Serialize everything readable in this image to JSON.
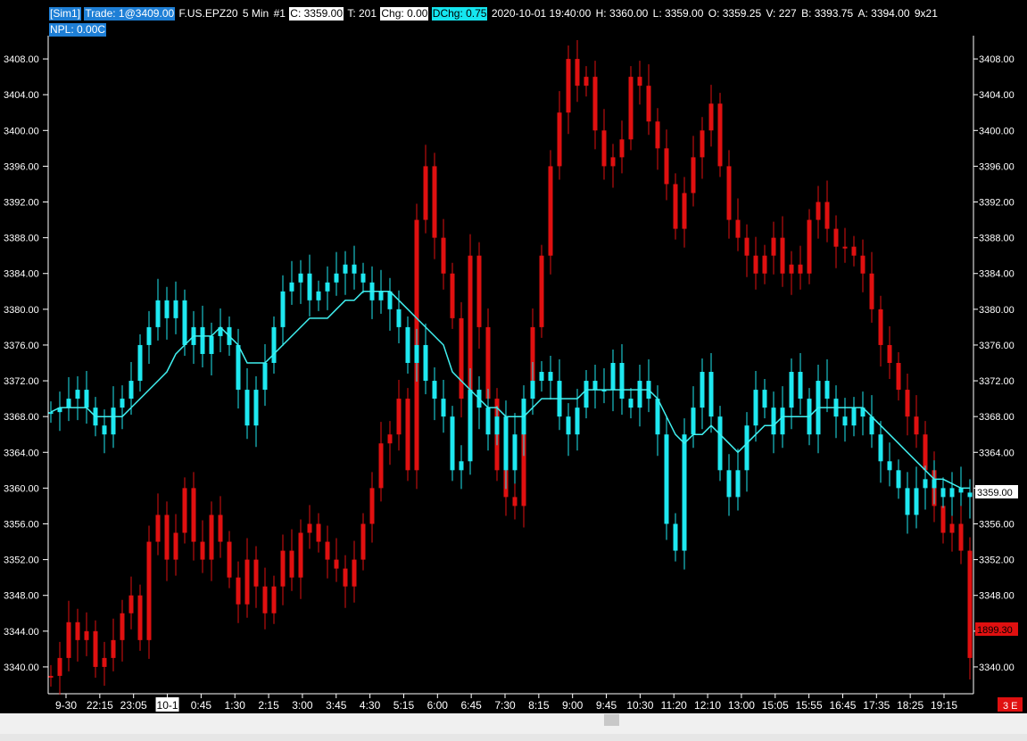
{
  "header": {
    "account": "[Sim1]",
    "trade": "Trade: 1@3409.00",
    "symbol": "F.US.EPZ20",
    "interval": "5 Min",
    "chart_no": "#1",
    "close": "C: 3359.00",
    "ticks": "T: 201",
    "chg": "Chg: 0.00",
    "dchg": "DChg: 0.75",
    "datetime": "2020-10-01 19:40:00",
    "high": "H: 3360.00",
    "low": "L: 3359.00",
    "open": "O: 3359.25",
    "volume": "V: 227",
    "bid": "B: 3393.75",
    "ask": "A: 3394.00",
    "size": "9x21",
    "npl": "NPL: 0.00C"
  },
  "price_tag": "3359.00",
  "red_tag": "1899.30",
  "corner_tag": "3 E",
  "colors": {
    "cyan": "#1ee8f0",
    "red": "#e01010",
    "ma": "#40f0f0",
    "axis": "#ffffff",
    "bg": "#000000"
  },
  "chart_data": {
    "type": "candlestick",
    "ylim": [
      3337,
      3411
    ],
    "y_ticks": [
      "3340.00",
      "3344.00",
      "3348.00",
      "3352.00",
      "3356.00",
      "3360.00",
      "3364.00",
      "3368.00",
      "3372.00",
      "3376.00",
      "3380.00",
      "3384.00",
      "3388.00",
      "3392.00",
      "3396.00",
      "3400.00",
      "3404.00",
      "3408.00"
    ],
    "x_ticks": [
      "9-30",
      "22:15",
      "23:05",
      "10-1",
      "0:45",
      "1:30",
      "2:15",
      "3:00",
      "3:45",
      "4:30",
      "5:15",
      "6:00",
      "6:45",
      "7:30",
      "8:15",
      "9:00",
      "9:45",
      "10:30",
      "11:20",
      "12:10",
      "13:00",
      "15:05",
      "15:55",
      "16:45",
      "17:35",
      "18:25",
      "19:15"
    ],
    "highlight_tick": "10-1",
    "series": [
      {
        "name": "",
        "color": "#1ee8f0",
        "values": [
          3368.5,
          3369,
          3370,
          3371,
          3369,
          3367,
          3366,
          3369,
          3370,
          3372,
          3376,
          3378,
          3381,
          3379,
          3381,
          3376,
          3378,
          3375,
          3377,
          3378,
          3376,
          3371,
          3367,
          3371,
          3374,
          3378,
          3382,
          3383,
          3384,
          3381,
          3382,
          3383,
          3384,
          3385,
          3384,
          3383,
          3381,
          3382,
          3380,
          3378,
          3374,
          3376,
          3372,
          3370,
          3368,
          3362,
          3363,
          3371,
          3369,
          3366,
          3368,
          3362,
          3366,
          3370,
          3372,
          3373,
          3372,
          3368,
          3366,
          3369,
          3372,
          3371,
          3371,
          3374,
          3370,
          3369,
          3372,
          3370,
          3366,
          3356,
          3353,
          3366,
          3369,
          3373,
          3368,
          3362,
          3359,
          3362,
          3367,
          3371,
          3369,
          3366,
          3369,
          3373,
          3370,
          3366,
          3372,
          3370,
          3368,
          3367,
          3369,
          3368,
          3366,
          3363,
          3362,
          3360,
          3357,
          3360,
          3361,
          3360,
          3359,
          3360,
          3359.5,
          3359
        ]
      },
      {
        "name": "",
        "color": "#e01010",
        "values": [
          3339,
          3341,
          3345,
          3343,
          3344,
          3340,
          3341,
          3343,
          3346,
          3348,
          3343,
          3354,
          3357,
          3352,
          3355,
          3360,
          3354,
          3352,
          3357,
          3354,
          3350,
          3347,
          3352,
          3349,
          3346,
          3349,
          3353,
          3350,
          3355,
          3356,
          3354,
          3352,
          3351,
          3349,
          3352,
          3356,
          3360,
          3365,
          3366,
          3370,
          3362,
          3390,
          3396,
          3388,
          3384,
          3379,
          3370,
          3386,
          3378,
          3370,
          3362,
          3359,
          3358,
          3370,
          3378,
          3386,
          3396,
          3402,
          3408,
          3405,
          3406,
          3400,
          3396,
          3397,
          3399,
          3406,
          3405,
          3401,
          3398,
          3394,
          3389,
          3393,
          3397,
          3400,
          3403,
          3396,
          3390,
          3388,
          3386,
          3384,
          3386,
          3388,
          3384,
          3385,
          3384,
          3390,
          3392,
          3389,
          3387,
          3387,
          3386,
          3384,
          3380,
          3376,
          3374,
          3371,
          3368,
          3366,
          3362,
          3358,
          3355,
          3356,
          3353,
          3341
        ]
      }
    ],
    "moving_average": [
      3368.5,
      3369,
      3369,
      3369,
      3369,
      3368,
      3368,
      3368,
      3368,
      3369,
      3370,
      3371,
      3372,
      3373,
      3375,
      3376,
      3377,
      3377,
      3377,
      3378,
      3377,
      3376,
      3374,
      3374,
      3374,
      3375,
      3376,
      3377,
      3378,
      3379,
      3379,
      3379,
      3380,
      3381,
      3381,
      3382,
      3382,
      3382,
      3382,
      3381,
      3380,
      3379,
      3378,
      3377,
      3376,
      3373,
      3372,
      3371,
      3370,
      3369,
      3369,
      3368,
      3368,
      3368,
      3369,
      3370,
      3370,
      3370,
      3370,
      3370,
      3371,
      3371,
      3371,
      3371,
      3371,
      3371,
      3371,
      3371,
      3370,
      3368,
      3366,
      3365,
      3366,
      3366,
      3367,
      3366,
      3365,
      3364,
      3365,
      3366,
      3367,
      3367,
      3368,
      3368,
      3368,
      3368,
      3369,
      3369,
      3369,
      3369,
      3369,
      3369,
      3368,
      3367,
      3366,
      3365,
      3364,
      3363,
      3362,
      3361,
      3361,
      3360.5,
      3360,
      3360
    ]
  }
}
